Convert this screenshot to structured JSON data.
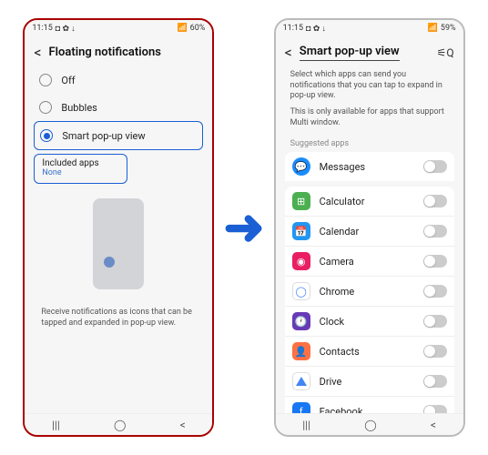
{
  "left": {
    "status": {
      "time": "11:15",
      "icons": "◘ ✿ ↓",
      "battery": "60%",
      "signal": "📶"
    },
    "header": {
      "title": "Floating notifications"
    },
    "options": [
      {
        "label": "Off",
        "selected": false
      },
      {
        "label": "Bubbles",
        "selected": false
      },
      {
        "label": "Smart pop-up view",
        "selected": true
      }
    ],
    "included": {
      "title": "Included apps",
      "sub": "None"
    },
    "preview_text": "Receive notifications as icons that can be tapped and expanded in pop-up view."
  },
  "right": {
    "status": {
      "time": "11:15",
      "icons": "◘ ✿ ↓",
      "battery": "59%",
      "signal": "📶"
    },
    "header": {
      "title": "Smart pop-up view"
    },
    "desc1": "Select which apps can send you notifications that you can tap to expand in pop-up view.",
    "desc2": "This is only available for apps that support Multi window.",
    "subhead": "Suggested apps",
    "apps": [
      {
        "label": "Messages",
        "icon_class": "ic-messages",
        "glyph": "💬"
      },
      {
        "label": "Calculator",
        "icon_class": "ic-calc",
        "glyph": "⊞"
      },
      {
        "label": "Calendar",
        "icon_class": "ic-cal",
        "glyph": "📅"
      },
      {
        "label": "Camera",
        "icon_class": "ic-cam",
        "glyph": "◉"
      },
      {
        "label": "Chrome",
        "icon_class": "ic-chrome",
        "glyph": "◯"
      },
      {
        "label": "Clock",
        "icon_class": "ic-clock",
        "glyph": "🕐"
      },
      {
        "label": "Contacts",
        "icon_class": "ic-contacts",
        "glyph": "👤"
      },
      {
        "label": "Drive",
        "icon_class": "ic-drive",
        "glyph": ""
      },
      {
        "label": "Facebook",
        "icon_class": "ic-fb",
        "glyph": "f"
      }
    ]
  },
  "nav": {
    "recent": "|||",
    "home": "◯",
    "back": "<"
  }
}
